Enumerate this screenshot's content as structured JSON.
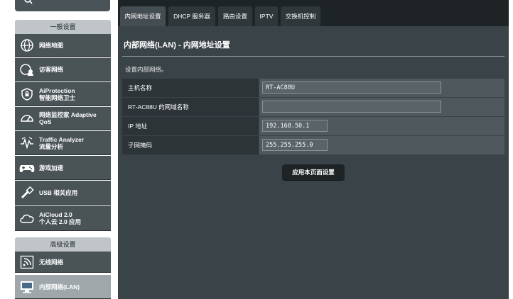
{
  "sidebar": {
    "general_header": "一般设置",
    "advanced_header": "高级设置",
    "general_items": [
      {
        "label": "网络地图",
        "icon": "network-map-icon"
      },
      {
        "label": "访客网络",
        "icon": "guest-network-icon"
      },
      {
        "label": "AiProtection\n智能网络卫士",
        "icon": "aiprotection-icon"
      },
      {
        "label": "网络监控家 Adaptive\nQoS",
        "icon": "adaptive-qos-icon"
      },
      {
        "label": "Traffic Analyzer\n流量分析",
        "icon": "traffic-analyzer-icon"
      },
      {
        "label": "游戏加速",
        "icon": "game-boost-icon"
      },
      {
        "label": "USB 相关应用",
        "icon": "usb-icon"
      },
      {
        "label": "AiCloud 2.0\n个人云 2.0 应用",
        "icon": "aicloud-icon"
      }
    ],
    "advanced_items": [
      {
        "label": "无线网络",
        "icon": "wireless-icon"
      },
      {
        "label": "内部网络(LAN)",
        "icon": "lan-icon"
      }
    ]
  },
  "tabs": [
    "内网地址设置",
    "DHCP 服务器",
    "路由设置",
    "IPTV",
    "交换机控制"
  ],
  "main": {
    "title": "内部网络(LAN) - 内网地址设置",
    "description": "设置内部网络。",
    "apply_label": "应用本页面设置"
  },
  "form": {
    "rows": [
      {
        "label": "主机名称",
        "value": "RT-AC88U"
      },
      {
        "label": "RT-AC88U 的网域名称",
        "value": ""
      },
      {
        "label": "IP 地址",
        "value": "192.168.50.1"
      },
      {
        "label": "子网掩码",
        "value": "255.255.255.0"
      }
    ]
  }
}
